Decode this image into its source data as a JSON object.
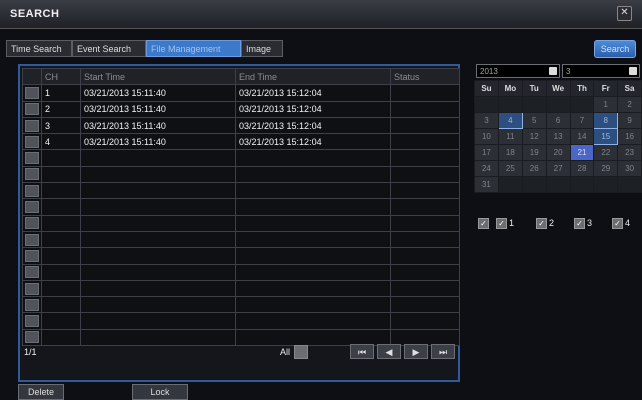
{
  "window": {
    "title": "SEARCH",
    "close_icon": "close-icon"
  },
  "tabs": [
    {
      "label": "Time Search",
      "active": false
    },
    {
      "label": "Event Search",
      "active": false
    },
    {
      "label": "File Management",
      "active": true
    },
    {
      "label": "Image",
      "active": false
    }
  ],
  "search_button": "Search",
  "table": {
    "headers": [
      "CH",
      "Start Time",
      "End Time",
      "Status"
    ],
    "rows": [
      {
        "ch": "1",
        "start": "03/21/2013 15:11:40",
        "end": "03/21/2013 15:12:04",
        "status": ""
      },
      {
        "ch": "2",
        "start": "03/21/2013 15:11:40",
        "end": "03/21/2013 15:12:04",
        "status": ""
      },
      {
        "ch": "3",
        "start": "03/21/2013 15:11:40",
        "end": "03/21/2013 15:12:04",
        "status": ""
      },
      {
        "ch": "4",
        "start": "03/21/2013 15:11:40",
        "end": "03/21/2013 15:12:04",
        "status": ""
      }
    ],
    "empty_rows": 12
  },
  "pager": {
    "page_info": "1/1",
    "all_label": "All",
    "buttons": [
      "⏮",
      "◀",
      "▶",
      "⏭"
    ]
  },
  "actions": {
    "delete": "Delete",
    "lock": "Lock"
  },
  "calendar": {
    "year": "2013",
    "month": "3",
    "weekdays": [
      "Su",
      "Mo",
      "Tu",
      "We",
      "Th",
      "Fr",
      "Sa"
    ],
    "days": [
      "",
      "",
      "",
      "",
      "",
      "1",
      "2",
      "3",
      "4",
      "5",
      "6",
      "7",
      "8",
      "9",
      "10",
      "11",
      "12",
      "13",
      "14",
      "15",
      "16",
      "17",
      "18",
      "19",
      "20",
      "21",
      "22",
      "23",
      "24",
      "25",
      "26",
      "27",
      "28",
      "29",
      "30",
      "31",
      "",
      "",
      "",
      "",
      "",
      ""
    ],
    "record_days": [
      "4",
      "8",
      "15"
    ],
    "selected_day": "21",
    "channels": [
      {
        "label": "1",
        "checked": true
      },
      {
        "label": "2",
        "checked": true
      },
      {
        "label": "3",
        "checked": true
      },
      {
        "label": "4",
        "checked": true
      }
    ]
  }
}
